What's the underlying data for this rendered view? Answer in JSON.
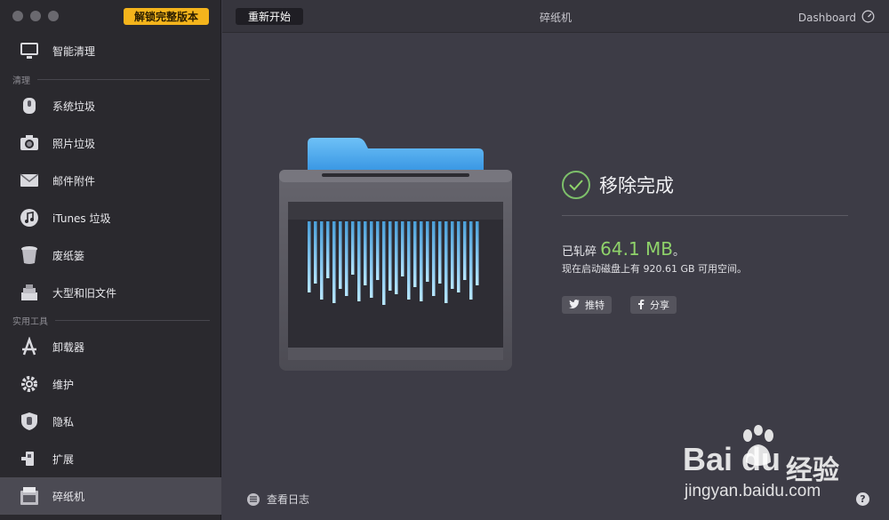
{
  "app": {
    "unlock_label": "解锁完整版本",
    "window_title": "碎纸机"
  },
  "toolbar": {
    "restart_label": "重新开始",
    "dashboard_label": "Dashboard"
  },
  "sidebar": {
    "top_item": {
      "label": "智能清理",
      "icon": "monitor-icon"
    },
    "sections": [
      {
        "title": "清理",
        "items": [
          {
            "label": "系统垃圾",
            "icon": "system-junk-icon"
          },
          {
            "label": "照片垃圾",
            "icon": "camera-icon"
          },
          {
            "label": "邮件附件",
            "icon": "mail-icon"
          },
          {
            "label": "iTunes 垃圾",
            "icon": "music-icon"
          },
          {
            "label": "废纸篓",
            "icon": "trash-icon"
          },
          {
            "label": "大型和旧文件",
            "icon": "files-stack-icon"
          }
        ]
      },
      {
        "title": "实用工具",
        "items": [
          {
            "label": "卸载器",
            "icon": "app-store-icon"
          },
          {
            "label": "维护",
            "icon": "gear-icon"
          },
          {
            "label": "隐私",
            "icon": "hand-shield-icon"
          },
          {
            "label": "扩展",
            "icon": "plugin-icon"
          },
          {
            "label": "碎纸机",
            "icon": "shredder-icon",
            "active": true
          }
        ]
      }
    ]
  },
  "result": {
    "status": "移除完成",
    "shredded_prefix": "已轧碎",
    "shredded_size": "64.1 MB",
    "shredded_suffix": "。",
    "free_space_text": "现在启动磁盘上有 920.61 GB 可用空间。",
    "tweet_label": "推特",
    "share_label": "分享"
  },
  "footer": {
    "log_label": "查看日志",
    "help_label": "?"
  },
  "watermark": {
    "brand": "Bai  du",
    "product": "经验",
    "url": "jingyan.baidu.com"
  },
  "colors": {
    "accent_green": "#8fd26a",
    "unlock_bg": "#f4b41c",
    "sidebar_bg": "#2a292e",
    "main_bg": "#3d3c46"
  }
}
